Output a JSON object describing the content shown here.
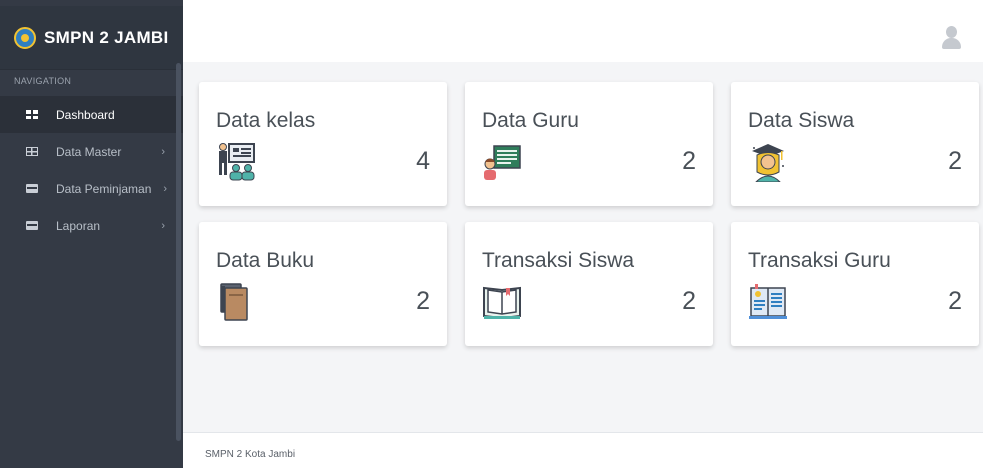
{
  "brand": {
    "title": "SMPN 2 JAMBI",
    "logo_icon": "school-emblem"
  },
  "sidebar": {
    "header": "NAVIGATION",
    "items": [
      {
        "label": "Dashboard",
        "icon": "dashboard-icon",
        "active": true
      },
      {
        "label": "Data Master",
        "icon": "table-icon",
        "chevron": "›"
      },
      {
        "label": "Data Peminjaman",
        "icon": "card-icon",
        "chevron": "›"
      },
      {
        "label": "Laporan",
        "icon": "card-icon",
        "chevron": "›"
      }
    ]
  },
  "topbar": {
    "user_icon": "user-avatar-icon"
  },
  "cards": [
    {
      "title": "Data kelas",
      "count": "4",
      "icon": "classroom-icon"
    },
    {
      "title": "Data Guru",
      "count": "2",
      "icon": "teacher-icon"
    },
    {
      "title": "Data Siswa",
      "count": "2",
      "icon": "student-icon"
    },
    {
      "title": "Data Buku",
      "count": "2",
      "icon": "book-icon"
    },
    {
      "title": "Transaksi Siswa",
      "count": "2",
      "icon": "open-book-icon"
    },
    {
      "title": "Transaksi Guru",
      "count": "2",
      "icon": "report-book-icon"
    }
  ],
  "footer": {
    "text": "SMPN 2 Kota Jambi"
  },
  "colors": {
    "sidebar": "#343a45",
    "active_item": "#2b3039",
    "content_bg": "#f4f5f7",
    "text": "#495057"
  }
}
